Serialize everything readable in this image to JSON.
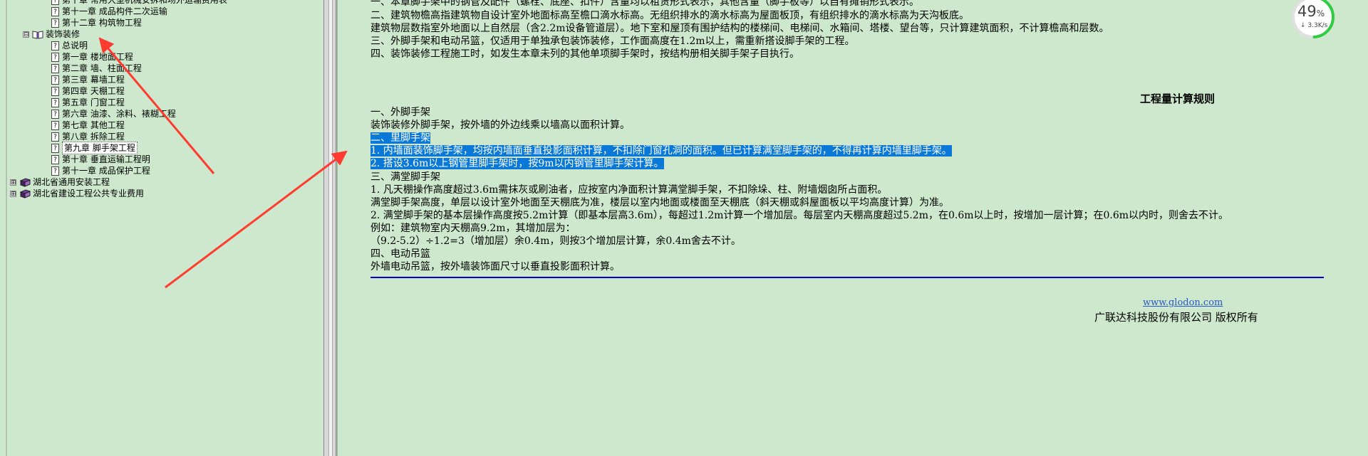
{
  "tree": {
    "items": [
      {
        "label": "第十章 常用大型机械安拆和场外运输费用表",
        "icon": "doc-icon",
        "level": 2
      },
      {
        "label": "第十一章 成品构件二次运输",
        "icon": "doc-icon",
        "level": 2
      },
      {
        "label": "第十二章 构筑物工程",
        "icon": "doc-icon",
        "level": 2
      },
      {
        "label": "装饰装修",
        "icon": "open-book-icon",
        "level": 1,
        "expander": "⊟",
        "selected": true
      },
      {
        "label": "总说明",
        "icon": "doc-icon",
        "level": 2
      },
      {
        "label": "第一章 楼地面工程",
        "icon": "doc-icon",
        "level": 2
      },
      {
        "label": "第二章 墙、柱面工程",
        "icon": "doc-icon",
        "level": 2
      },
      {
        "label": "第三章 幕墙工程",
        "icon": "doc-icon",
        "level": 2
      },
      {
        "label": "第四章 天棚工程",
        "icon": "doc-icon",
        "level": 2
      },
      {
        "label": "第五章 门窗工程",
        "icon": "doc-icon",
        "level": 2
      },
      {
        "label": "第六章 油漆、涂料、裱糊工程",
        "icon": "doc-icon",
        "level": 2
      },
      {
        "label": "第七章 其他工程",
        "icon": "doc-icon",
        "level": 2
      },
      {
        "label": "第八章 拆除工程",
        "icon": "doc-icon",
        "level": 2
      },
      {
        "label": "第九章 脚手架工程",
        "icon": "doc-icon",
        "level": 2,
        "boxed": true
      },
      {
        "label": "第十章 垂直运输工程明",
        "icon": "doc-icon",
        "level": 2
      },
      {
        "label": "第十一章 成品保护工程",
        "icon": "doc-icon",
        "level": 2
      },
      {
        "label": "湖北省通用安装工程",
        "icon": "book-icon",
        "level": 0,
        "expander": "⊞"
      },
      {
        "label": "湖北省建设工程公共专业费用",
        "icon": "book-icon",
        "level": 0,
        "expander": "⊞"
      }
    ]
  },
  "content": {
    "notes": [
      "一、本章脚手架中的钢管及配件（螺栓、底座、扣件）含量均以租赁形式表示，其他含量（脚手板等）以自有摊销形式表示。",
      "二、建筑物檐高指建筑物自设计室外地面标高至檐口滴水标高。无组织排水的滴水标高为屋面板顶，有组织排水的滴水标高为天沟板底。",
      "建筑物层数指室外地面以上自然层（含2.2m设备管道层）。地下室和屋顶有围护结构的楼梯间、电梯间、水箱间、塔楼、望台等，只计算建筑面积，不计算檐高和层数。",
      "三、外脚手架和电动吊篮，仅适用于单独承包装饰装修，工作面高度在1.2m以上，需重新搭设脚手架的工程。",
      "四、装饰装修工程施工时，如发生本章未列的其他单项脚手架时，按结构册相关脚手架子目执行。"
    ],
    "rules_heading": "工程量计算规则",
    "rules": [
      {
        "text": "一、外脚手架",
        "hl": false
      },
      {
        "text": "装饰装修外脚手架，按外墙的外边线乘以墙高以面积计算。",
        "hl": false
      },
      {
        "text": "二、里脚手架",
        "hl": true
      },
      {
        "text": "1. 内墙面装饰脚手架，均按内墙面垂直投影面积计算，不扣除门窗孔洞的面积。但已计算满堂脚手架的，不得再计算内墙里脚手架。",
        "hl": true
      },
      {
        "text": "2. 搭设3.6m以上钢管里脚手架时，按9m以内钢管里脚手架计算。",
        "hl": true
      },
      {
        "text": "三、满堂脚手架",
        "hl": false
      },
      {
        "text": "1. 凡天棚操作高度超过3.6m需抹灰或刷油者，应按室内净面积计算满堂脚手架，不扣除垛、柱、附墙烟囱所占面积。",
        "hl": false
      },
      {
        "text": "满堂脚手架高度，单层以设计室外地面至天棚底为准，楼层以室内地面或楼面至天棚底（斜天棚或斜屋面板以平均高度计算）为准。",
        "hl": false
      },
      {
        "text": "2. 满堂脚手架的基本层操作高度按5.2m计算（即基本层高3.6m），每超过1.2m计算一个增加层。每层室内天棚高度超过5.2m，在0.6m以上时，按增加一层计算；在0.6m以内时，则舍去不计。",
        "hl": false
      },
      {
        "text": "例如：建筑物室内天棚高9.2m，其增加层为：",
        "hl": false
      },
      {
        "text": "（9.2-5.2）÷1.2=3（增加层）余0.4m，则按3个增加层计算，余0.4m舍去不计。",
        "hl": false
      },
      {
        "text": "四、电动吊篮",
        "hl": false
      },
      {
        "text": "外墙电动吊篮，按外墙装饰面尺寸以垂直投影面积计算。",
        "hl": false
      }
    ],
    "footer_link": "www.glodon.com",
    "footer_copy": "广联达科技股份有限公司 版权所有"
  },
  "widget": {
    "percent": "49",
    "percent_unit": "%",
    "rate": "↓ 3.3K/s",
    "progress": 0.49,
    "ring_color": "#2ecc40"
  },
  "colors": {
    "background": "#cde8cd",
    "selection": "#0a78d7",
    "rule": "#0000cc",
    "arrow": "#ff3b30"
  }
}
